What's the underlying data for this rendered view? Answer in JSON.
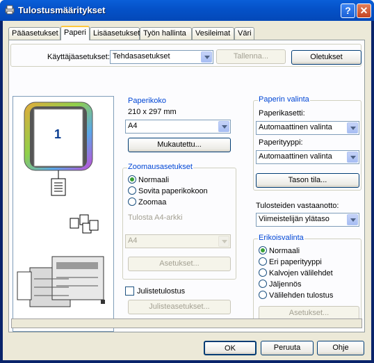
{
  "window": {
    "title": "Tulostusmääritykset",
    "help_label": "?",
    "close_label": "✕"
  },
  "tabs": [
    {
      "label": "Pääasetukset"
    },
    {
      "label": "Paperi"
    },
    {
      "label": "Lisäasetukset"
    },
    {
      "label": "Työn hallinta"
    },
    {
      "label": "Vesileimat"
    },
    {
      "label": "Väri"
    }
  ],
  "user_settings": {
    "label": "Käyttäjäasetukset:",
    "value": "Tehdasasetukset",
    "save_label": "Tallenna...",
    "defaults_label": "Oletukset"
  },
  "preview": {
    "page_number": "1"
  },
  "paper_size": {
    "legend": "Paperikoko",
    "dimensions": "210 x 297 mm",
    "value": "A4",
    "custom_label": "Mukautettu..."
  },
  "zoom": {
    "legend": "Zoomausasetukset",
    "options": [
      "Normaali",
      "Sovita paperikokoon",
      "Zoomaa"
    ],
    "selected": "Normaali",
    "fit_label": "Tulosta A4-arkki",
    "fit_value": "A4",
    "settings_label": "Asetukset..."
  },
  "poster": {
    "checkbox_label": "Julistetulostus",
    "settings_label": "Julisteasetukset..."
  },
  "paper_select": {
    "legend": "Paperin valinta",
    "tray_label": "Paperikasetti:",
    "tray_value": "Automaattinen valinta",
    "type_label": "Paperityyppi:",
    "type_value": "Automaattinen valinta",
    "tray_status_label": "Tason tila..."
  },
  "output": {
    "label": "Tulosteiden vastaanotto:",
    "value": "Viimeistelijän ylätaso"
  },
  "special": {
    "legend": "Erikoisvalinta",
    "options": [
      "Normaali",
      "Eri paperityyppi",
      "Kalvojen välilehdet",
      "Jäljennös",
      "Välilehden tulostus"
    ],
    "selected": "Normaali",
    "settings_label": "Asetukset..."
  },
  "footer": {
    "ok_label": "OK",
    "cancel_label": "Peruuta",
    "help_label": "Ohje"
  }
}
